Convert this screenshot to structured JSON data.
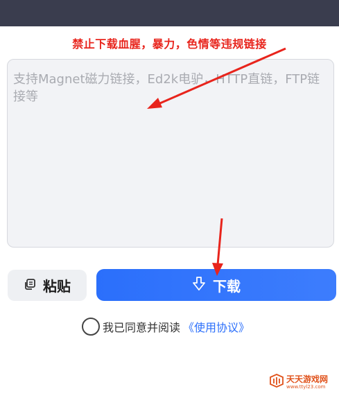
{
  "warning_text": "禁止下载血腥，暴力，色情等违规链接",
  "link_input": {
    "placeholder": "支持Magnet磁力链接，Ed2k电驴，HTTP直链，FTP链接等",
    "value": ""
  },
  "paste_button": {
    "label": "粘贴",
    "icon": "copy-icon"
  },
  "download_button": {
    "label": "下载",
    "icon": "download-arrow-icon"
  },
  "agreement": {
    "text": "我已同意并阅读",
    "link": "《使用协议》",
    "checked": false
  },
  "watermark": {
    "name": "天天游戏网",
    "url": "www.ttyl23.com"
  },
  "colors": {
    "top_bar": "#3a3d4e",
    "warning_red": "#e8241c",
    "accent_blue": "#2b6ffb",
    "annotation_arrow": "#e8241c"
  }
}
